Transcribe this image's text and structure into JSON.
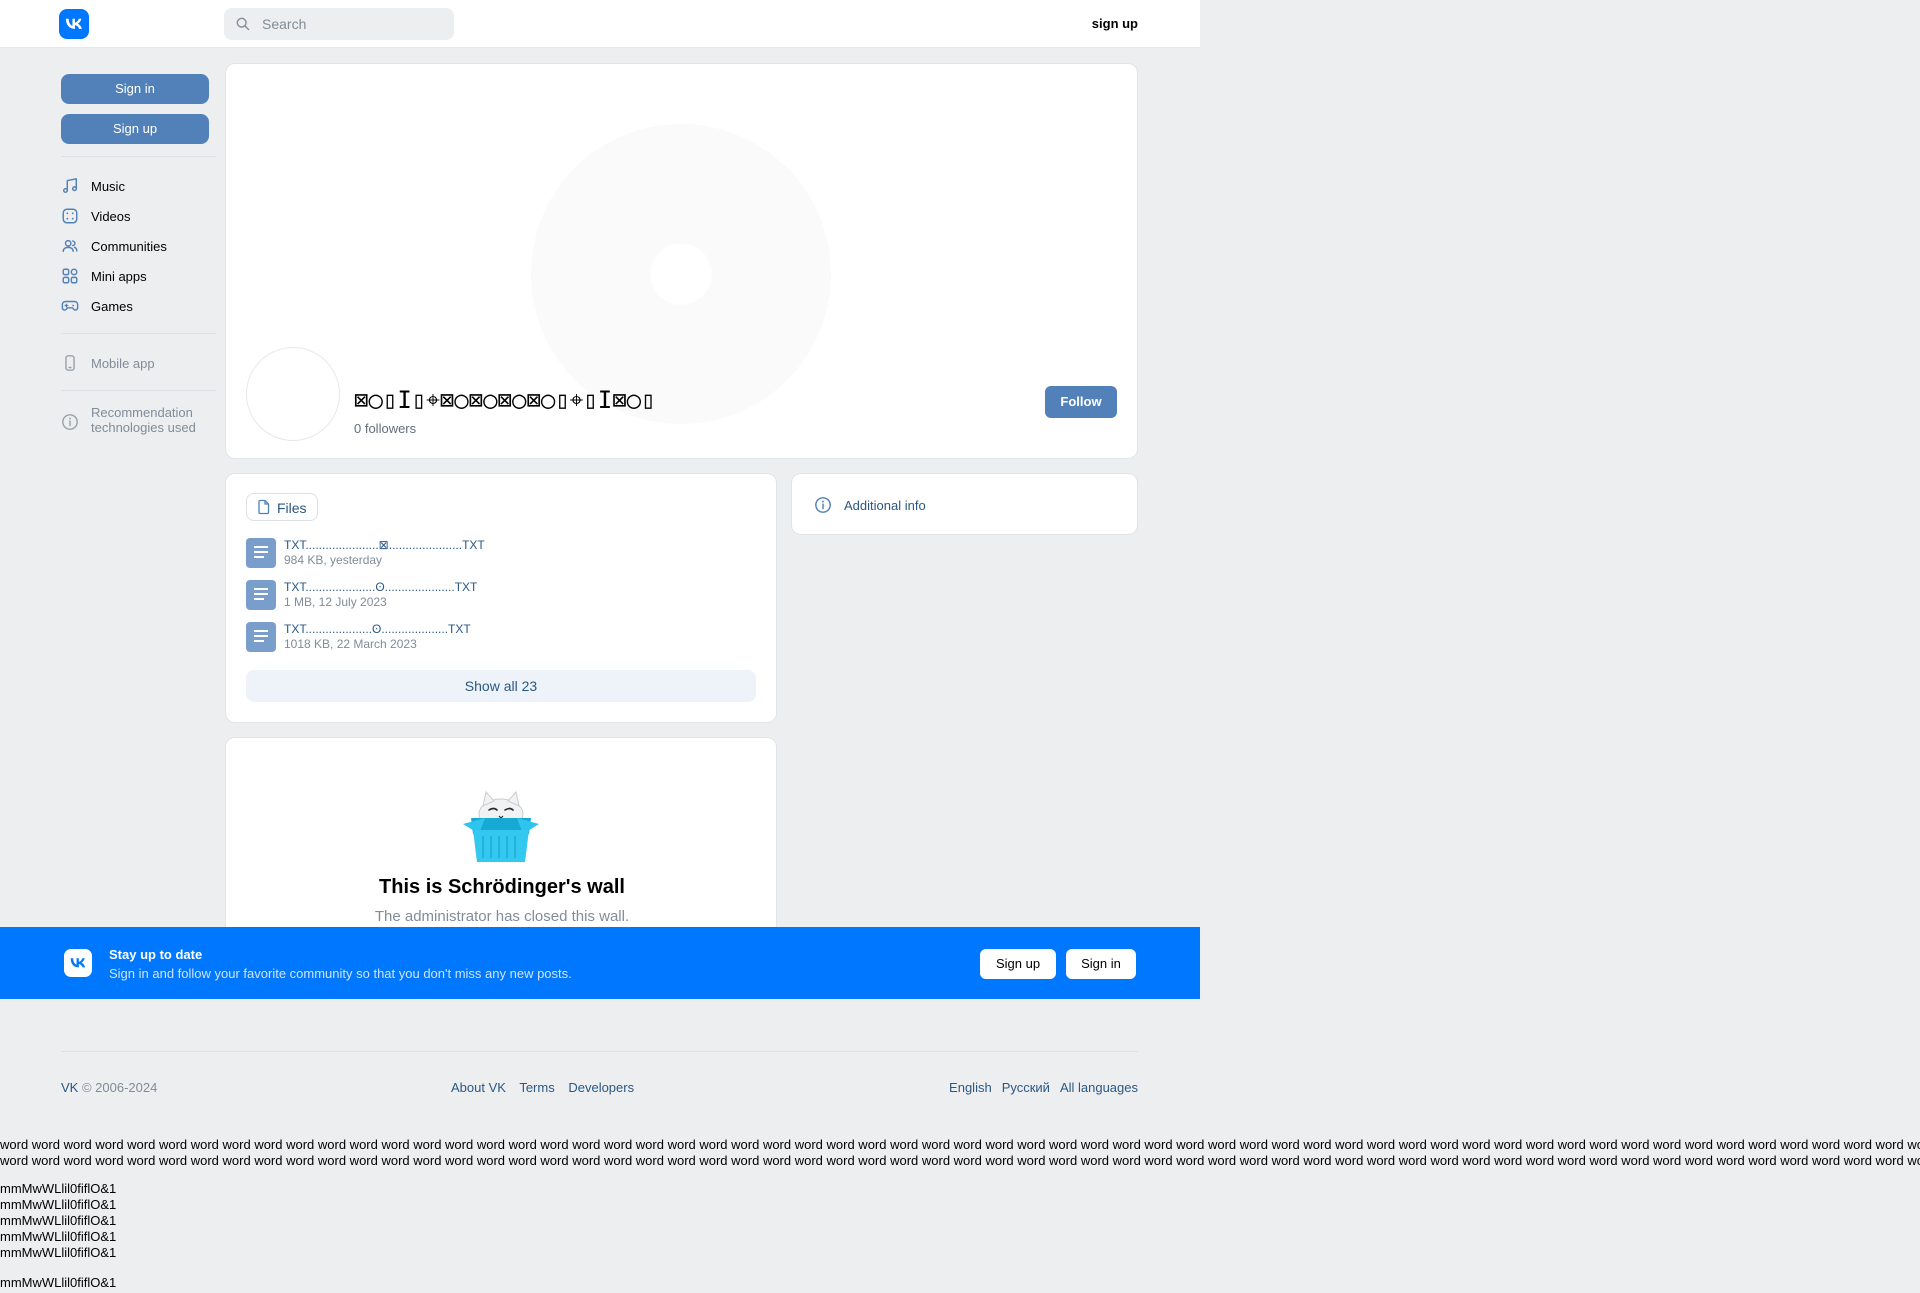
{
  "header": {
    "search_placeholder": "Search",
    "signup_label": "sign up"
  },
  "sidebar": {
    "signin_label": "Sign in",
    "signup_label": "Sign up",
    "items": [
      {
        "label": "Music",
        "icon": "music-icon"
      },
      {
        "label": "Videos",
        "icon": "video-icon"
      },
      {
        "label": "Communities",
        "icon": "communities-icon"
      },
      {
        "label": "Mini apps",
        "icon": "mini-apps-icon"
      },
      {
        "label": "Games",
        "icon": "gamepad-icon"
      }
    ],
    "mobile_app": "Mobile app",
    "rec_line1": "Recommendation",
    "rec_line2": "technologies used"
  },
  "profile": {
    "name": "⊠○▯I▯⌖⊠○⊠○⊠○⊠○▯⌖▯I⊠○▯",
    "followers": "0 followers",
    "follow_label": "Follow"
  },
  "files": {
    "tab_label": "Files",
    "items": [
      {
        "name": "TXT......................⊠......................TXT",
        "meta": "984 KB, yesterday"
      },
      {
        "name": "TXT.....................ʘ.....................TXT",
        "meta": "1 MB, 12 July 2023"
      },
      {
        "name": "TXT....................ʘ....................TXT",
        "meta": "1018 KB, 22 March 2023"
      }
    ],
    "show_all": "Show all 23"
  },
  "additional_info": "Additional info",
  "wall": {
    "title": "This is Schrödinger's wall",
    "subtitle": "The administrator has closed this wall."
  },
  "banner": {
    "title": "Stay up to date",
    "subtitle": "Sign in and follow your favorite community so that you don't miss any new posts.",
    "signup": "Sign up",
    "signin": "Sign in"
  },
  "footer": {
    "vk": "VK",
    "copyright": " © 2006-2024",
    "links": [
      "About VK",
      "Terms",
      "Developers"
    ],
    "langs": [
      "English",
      "Русский",
      "All languages"
    ]
  },
  "dump": {
    "word_line": "word word word word word word word word word word word word word word word word word word word word word word word word word word word word word word word word word word word word word word word word word word word word word word word word word word word word word word word word word word word word word word word word",
    "mm_line": "mmMwWLlil0fiflO&1"
  },
  "colors": {
    "accent": "#0077ff",
    "button": "#5181b8",
    "link": "#2a5885",
    "bg": "#edeef0"
  }
}
